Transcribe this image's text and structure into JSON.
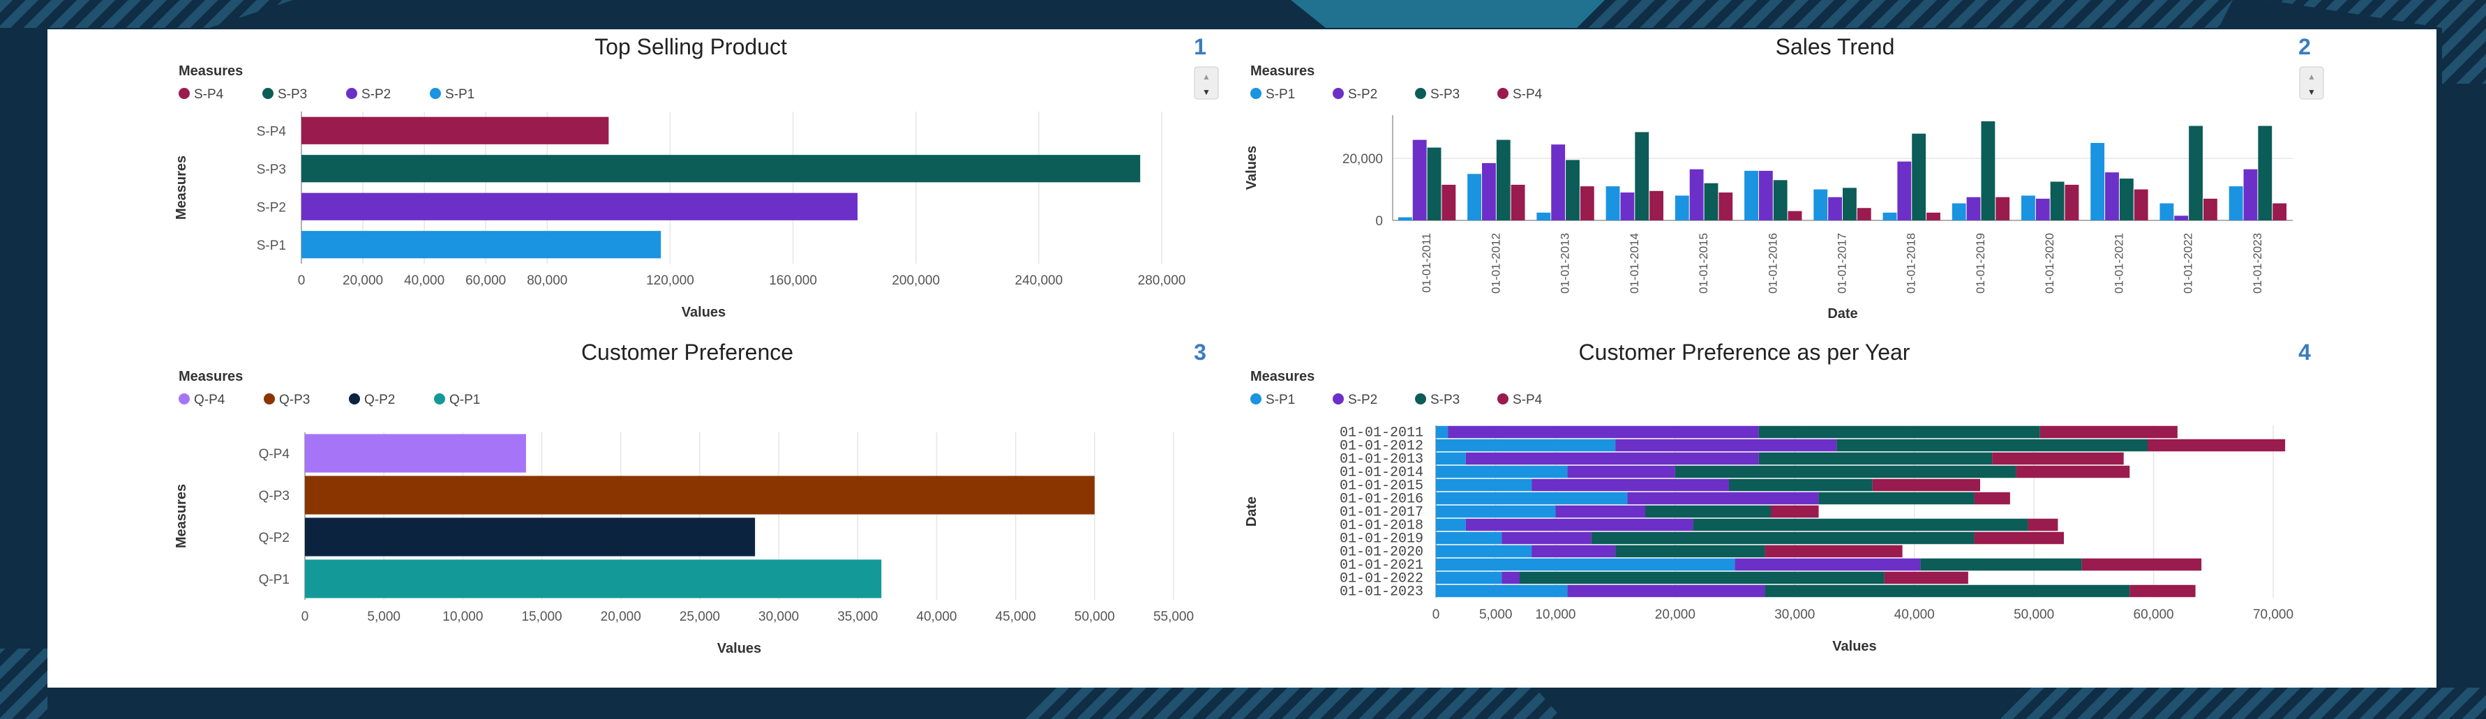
{
  "colors": {
    "p1": "#1a93e0",
    "p2": "#6c2fc7",
    "p3": "#0c5c58",
    "p4": "#9a1b4d",
    "q1": "#139a98",
    "q2": "#0c2340",
    "q3": "#8a3500",
    "q4": "#a675f7"
  },
  "scroll": {
    "up": "▲",
    "down": "▼"
  },
  "chart_data": [
    {
      "id": "1",
      "type": "bar",
      "orientation": "horizontal",
      "title": "Top Selling Product",
      "number": "1",
      "legend_title": "Measures",
      "legend": [
        "S-P4",
        "S-P3",
        "S-P2",
        "S-P1"
      ],
      "ylabel": "Measures",
      "xlabel": "Values",
      "categories": [
        "S-P4",
        "S-P3",
        "S-P2",
        "S-P1"
      ],
      "values": [
        100000,
        273000,
        181000,
        117000
      ],
      "colors": [
        "#9a1b4d",
        "#0c5c58",
        "#6c2fc7",
        "#1a93e0"
      ],
      "ticks": [
        {
          "v": 0,
          "label": "0"
        },
        {
          "v": 20000,
          "label": "20,000"
        },
        {
          "v": 40000,
          "label": "40,000"
        },
        {
          "v": 60000,
          "label": "60,000"
        },
        {
          "v": 80000,
          "label": "80,000"
        },
        {
          "v": 120000,
          "label": "120,000"
        },
        {
          "v": 160000,
          "label": "160,000"
        },
        {
          "v": 200000,
          "label": "200,000"
        },
        {
          "v": 240000,
          "label": "240,000"
        },
        {
          "v": 280000,
          "label": "280,000"
        }
      ],
      "xlim": [
        0,
        280000
      ]
    },
    {
      "id": "2",
      "type": "bar",
      "orientation": "vertical",
      "title": "Sales Trend",
      "number": "2",
      "legend_title": "Measures",
      "legend": [
        "S-P1",
        "S-P2",
        "S-P3",
        "S-P4"
      ],
      "ylabel": "Values",
      "xlabel": "Date",
      "categories": [
        "01-01-2011",
        "01-01-2012",
        "01-01-2013",
        "01-01-2014",
        "01-01-2015",
        "01-01-2016",
        "01-01-2017",
        "01-01-2018",
        "01-01-2019",
        "01-01-2020",
        "01-01-2021",
        "01-01-2022",
        "01-01-2023"
      ],
      "series": [
        {
          "name": "S-P1",
          "color": "#1a93e0",
          "values": [
            1000,
            15000,
            2500,
            11000,
            8000,
            16000,
            10000,
            2500,
            5500,
            8000,
            25000,
            5500,
            11000
          ]
        },
        {
          "name": "S-P2",
          "color": "#6c2fc7",
          "values": [
            26000,
            18500,
            24500,
            9000,
            16500,
            16000,
            7500,
            19000,
            7500,
            7000,
            15500,
            1500,
            16500
          ]
        },
        {
          "name": "S-P3",
          "color": "#0c5c58",
          "values": [
            23500,
            26000,
            19500,
            28500,
            12000,
            13000,
            10500,
            28000,
            32000,
            12500,
            13500,
            30500,
            30500
          ]
        },
        {
          "name": "S-P4",
          "color": "#9a1b4d",
          "values": [
            11500,
            11500,
            11000,
            9500,
            9000,
            3000,
            4000,
            2500,
            7500,
            11500,
            10000,
            7000,
            5500
          ]
        }
      ],
      "ylim": [
        0,
        34000
      ],
      "yticks": [
        {
          "v": 0,
          "label": "0"
        },
        {
          "v": 20000,
          "label": "20,000"
        }
      ]
    },
    {
      "id": "3",
      "type": "bar",
      "orientation": "horizontal",
      "title": "Customer Preference",
      "number": "3",
      "legend_title": "Measures",
      "legend": [
        "Q-P4",
        "Q-P3",
        "Q-P2",
        "Q-P1"
      ],
      "ylabel": "Measures",
      "xlabel": "Values",
      "categories": [
        "Q-P4",
        "Q-P3",
        "Q-P2",
        "Q-P1"
      ],
      "values": [
        14000,
        50000,
        28500,
        36500
      ],
      "colors": [
        "#a675f7",
        "#8a3500",
        "#0c2340",
        "#139a98"
      ],
      "ticks": [
        {
          "v": 0,
          "label": "0"
        },
        {
          "v": 5000,
          "label": "5,000"
        },
        {
          "v": 10000,
          "label": "10,000"
        },
        {
          "v": 15000,
          "label": "15,000"
        },
        {
          "v": 20000,
          "label": "20,000"
        },
        {
          "v": 25000,
          "label": "25,000"
        },
        {
          "v": 30000,
          "label": "30,000"
        },
        {
          "v": 35000,
          "label": "35,000"
        },
        {
          "v": 40000,
          "label": "40,000"
        },
        {
          "v": 45000,
          "label": "45,000"
        },
        {
          "v": 50000,
          "label": "50,000"
        },
        {
          "v": 55000,
          "label": "55,000"
        }
      ],
      "xlim": [
        0,
        55000
      ]
    },
    {
      "id": "4",
      "type": "bar",
      "orientation": "horizontal",
      "stacked": true,
      "title": "Customer Preference as per Year",
      "number": "4",
      "legend_title": "Measures",
      "legend": [
        "S-P1",
        "S-P2",
        "S-P3",
        "S-P4"
      ],
      "ylabel": "Date",
      "xlabel": "Values",
      "categories": [
        "01-01-2011",
        "01-01-2012",
        "01-01-2013",
        "01-01-2014",
        "01-01-2015",
        "01-01-2016",
        "01-01-2017",
        "01-01-2018",
        "01-01-2019",
        "01-01-2020",
        "01-01-2021",
        "01-01-2022",
        "01-01-2023"
      ],
      "series": [
        {
          "name": "S-P1",
          "color": "#1a93e0",
          "values": [
            1000,
            15000,
            2500,
            11000,
            8000,
            16000,
            10000,
            2500,
            5500,
            8000,
            25000,
            5500,
            11000
          ]
        },
        {
          "name": "S-P2",
          "color": "#6c2fc7",
          "values": [
            26000,
            18500,
            24500,
            9000,
            16500,
            16000,
            7500,
            19000,
            7500,
            7000,
            15500,
            1500,
            16500
          ]
        },
        {
          "name": "S-P3",
          "color": "#0c5c58",
          "values": [
            23500,
            26000,
            19500,
            28500,
            12000,
            13000,
            10500,
            28000,
            32000,
            12500,
            13500,
            30500,
            30500
          ]
        },
        {
          "name": "S-P4",
          "color": "#9a1b4d",
          "values": [
            11500,
            11500,
            11000,
            9500,
            9000,
            3000,
            4000,
            2500,
            7500,
            11500,
            10000,
            7000,
            5500
          ]
        }
      ],
      "ticks": [
        {
          "v": 0,
          "label": "0"
        },
        {
          "v": 5000,
          "label": "5,000"
        },
        {
          "v": 10000,
          "label": "10,000"
        },
        {
          "v": 20000,
          "label": "20,000"
        },
        {
          "v": 30000,
          "label": "30,000"
        },
        {
          "v": 40000,
          "label": "40,000"
        },
        {
          "v": 50000,
          "label": "50,000"
        },
        {
          "v": 60000,
          "label": "60,000"
        },
        {
          "v": 70000,
          "label": "70,000"
        }
      ],
      "xlim": [
        0,
        70000
      ]
    }
  ]
}
